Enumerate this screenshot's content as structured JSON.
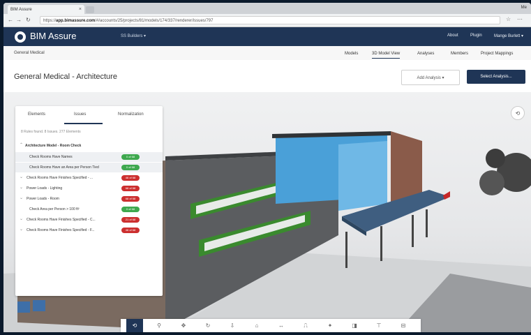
{
  "browser": {
    "tab_title": "BIM Assure",
    "tab_close": "×",
    "url_prefix": "https://",
    "url_host": "app.bimassure.com",
    "url_path": "/#/accounts/25/projects/81/models/174/337/renderer/issues/797",
    "window_label": "Me"
  },
  "header": {
    "brand": "BIM Assure",
    "org_selector": "SS Builders ▾",
    "links": [
      "About",
      "Plugin",
      "Mange Burlett ▾"
    ]
  },
  "subnav": {
    "breadcrumb": "General Medical",
    "tabs": [
      "Models",
      "3D Model View",
      "Analyses",
      "Members",
      "Project Mappings"
    ],
    "active_tab": "3D Model View"
  },
  "page": {
    "title": "General Medical - Architecture",
    "add_analysis_label": "Add Analysis ▾",
    "select_analysis_label": "Select Analysis..."
  },
  "panel": {
    "tabs": [
      "Elements",
      "Issues",
      "Normalization"
    ],
    "active_tab": "Issues",
    "summary": "8 Rules found. 8 Issues. 277 Elements",
    "group_title": "Architecture Model - Room Check",
    "rows": [
      {
        "label": "Check Rooms Have Names",
        "badge": "0 of 68",
        "status": "pass",
        "chevron": false
      },
      {
        "label": "Check Rooms Have an Area per Person Tied",
        "badge": "0 of 68",
        "status": "pass",
        "chevron": false
      },
      {
        "label": "Check Rooms Have Finishes Specified - ...",
        "badge": "46 of 68",
        "status": "fail",
        "chevron": true
      },
      {
        "label": "Power Loads - Lighting",
        "badge": "68 of 68",
        "status": "fail",
        "chevron": true
      },
      {
        "label": "Power Loads - Room",
        "badge": "68 of 68",
        "status": "fail",
        "chevron": true
      },
      {
        "label": "Check Area per Person > 100 ft²",
        "badge": "0 of 68",
        "status": "pass",
        "chevron": false
      },
      {
        "label": "Check Rooms Have Finishes Specified - C...",
        "badge": "21 of 68",
        "status": "fail",
        "chevron": true
      },
      {
        "label": "Check Rooms Have Finishes Specified - F...",
        "badge": "46 of 68",
        "status": "fail",
        "chevron": true
      }
    ]
  },
  "toolbar": {
    "tools": [
      "⟲",
      "⚲",
      "✥",
      "↻",
      "⇩",
      "⌂",
      "↔",
      "⎍",
      "✦",
      "◨",
      "⊤",
      "⊟"
    ]
  },
  "colors": {
    "brand_navy": "#1f3556",
    "pass_green": "#3ea84e",
    "fail_red": "#cc2f2f"
  }
}
